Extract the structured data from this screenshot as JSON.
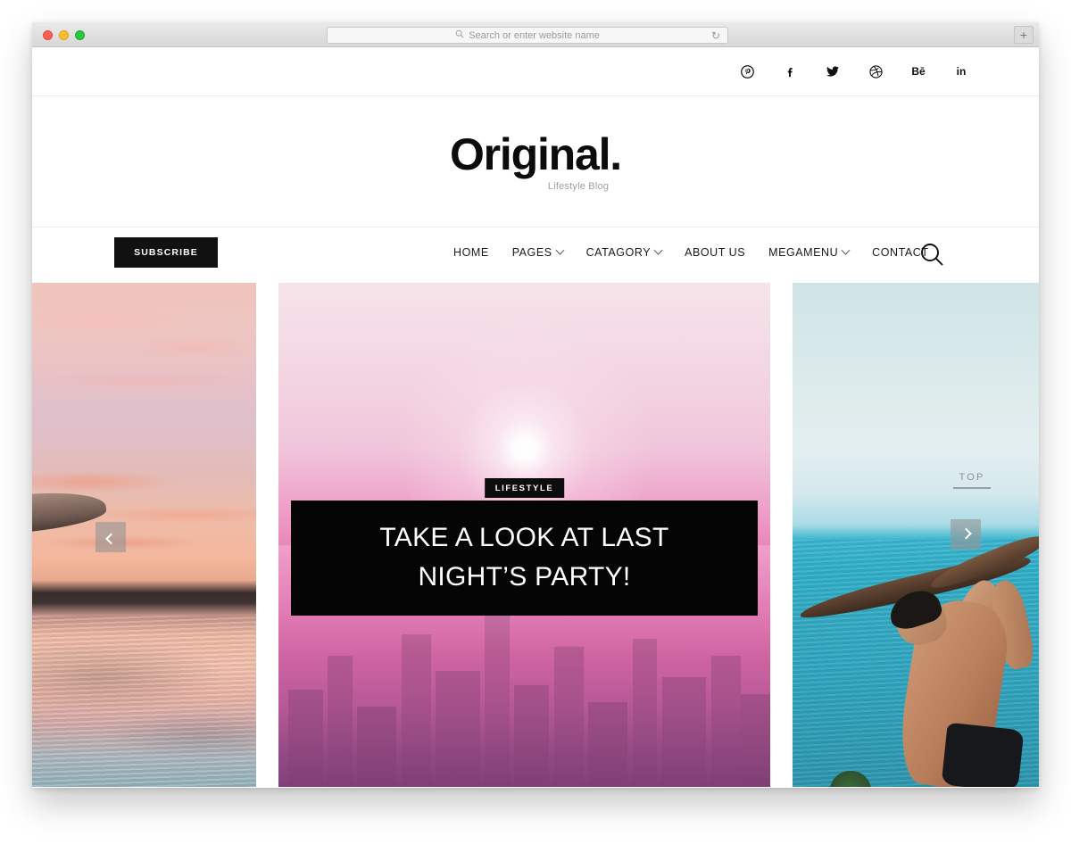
{
  "browser": {
    "url_placeholder": "Search or enter website name",
    "search_icon": "search-icon",
    "reload_icon": "reload-icon",
    "new_tab_label": "+"
  },
  "site": {
    "logo": "Original.",
    "tagline": "Lifestyle Blog"
  },
  "social": [
    {
      "name": "pinterest",
      "label": "P"
    },
    {
      "name": "facebook",
      "label": "f"
    },
    {
      "name": "twitter",
      "label": "t"
    },
    {
      "name": "dribbble",
      "label": "d"
    },
    {
      "name": "behance",
      "label": "Bē"
    },
    {
      "name": "linkedin",
      "label": "in"
    }
  ],
  "nav": {
    "subscribe_label": "SUBSCRIBE",
    "search_icon": "search-icon",
    "items": [
      {
        "label": "HOME",
        "has_dropdown": false
      },
      {
        "label": "PAGES",
        "has_dropdown": true
      },
      {
        "label": "CATAGORY",
        "has_dropdown": true
      },
      {
        "label": "ABOUT US",
        "has_dropdown": false
      },
      {
        "label": "MEGAMENU",
        "has_dropdown": true
      },
      {
        "label": "CONTACT",
        "has_dropdown": false
      }
    ]
  },
  "slider": {
    "prev_icon": "chevron-left-icon",
    "next_icon": "chevron-right-icon",
    "top_label": "TOP",
    "featured": {
      "category_badge": "LIFESTYLE",
      "headline_line1": "TAKE A LOOK AT LAST",
      "headline_line2": "NIGHT’S PARTY!"
    },
    "slides": [
      {
        "name": "beach-sunset-surfboard",
        "alt": "Pink sunset over beach with surfboard"
      },
      {
        "name": "pink-cityscape",
        "alt": "Hazy pink cityscape with sun"
      },
      {
        "name": "ocean-man-driftwood",
        "alt": "Man lifting driftwood over teal ocean"
      }
    ]
  },
  "colors": {
    "accent_black": "#111111",
    "text_dark": "#1a1a1a",
    "muted": "#9e9e9e",
    "divider": "#ececec"
  }
}
